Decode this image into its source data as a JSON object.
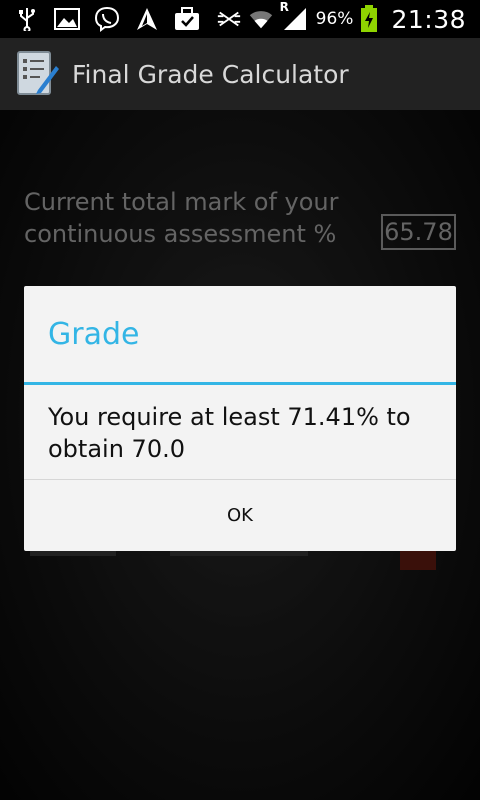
{
  "status_bar": {
    "icons_left": [
      "usb-icon",
      "image-icon",
      "viber-icon",
      "navigation-icon",
      "briefcase-icon"
    ],
    "icons_right": [
      "mute-icon",
      "wifi-icon",
      "signal-icon",
      "battery-icon"
    ],
    "roaming_mark": "R",
    "battery_percent": "96%",
    "time": "21:38"
  },
  "action_bar": {
    "title": "Final Grade Calculator"
  },
  "form": {
    "label": "Current total mark of your continuous assessment %",
    "value": "65.78"
  },
  "dialog": {
    "title": "Grade",
    "message": "You require at least 71.41% to obtain 70.0",
    "ok_label": "OK"
  },
  "colors": {
    "accent": "#33b5e5",
    "dialog_bg": "#f3f3f3",
    "action_bar_bg": "#222222"
  }
}
